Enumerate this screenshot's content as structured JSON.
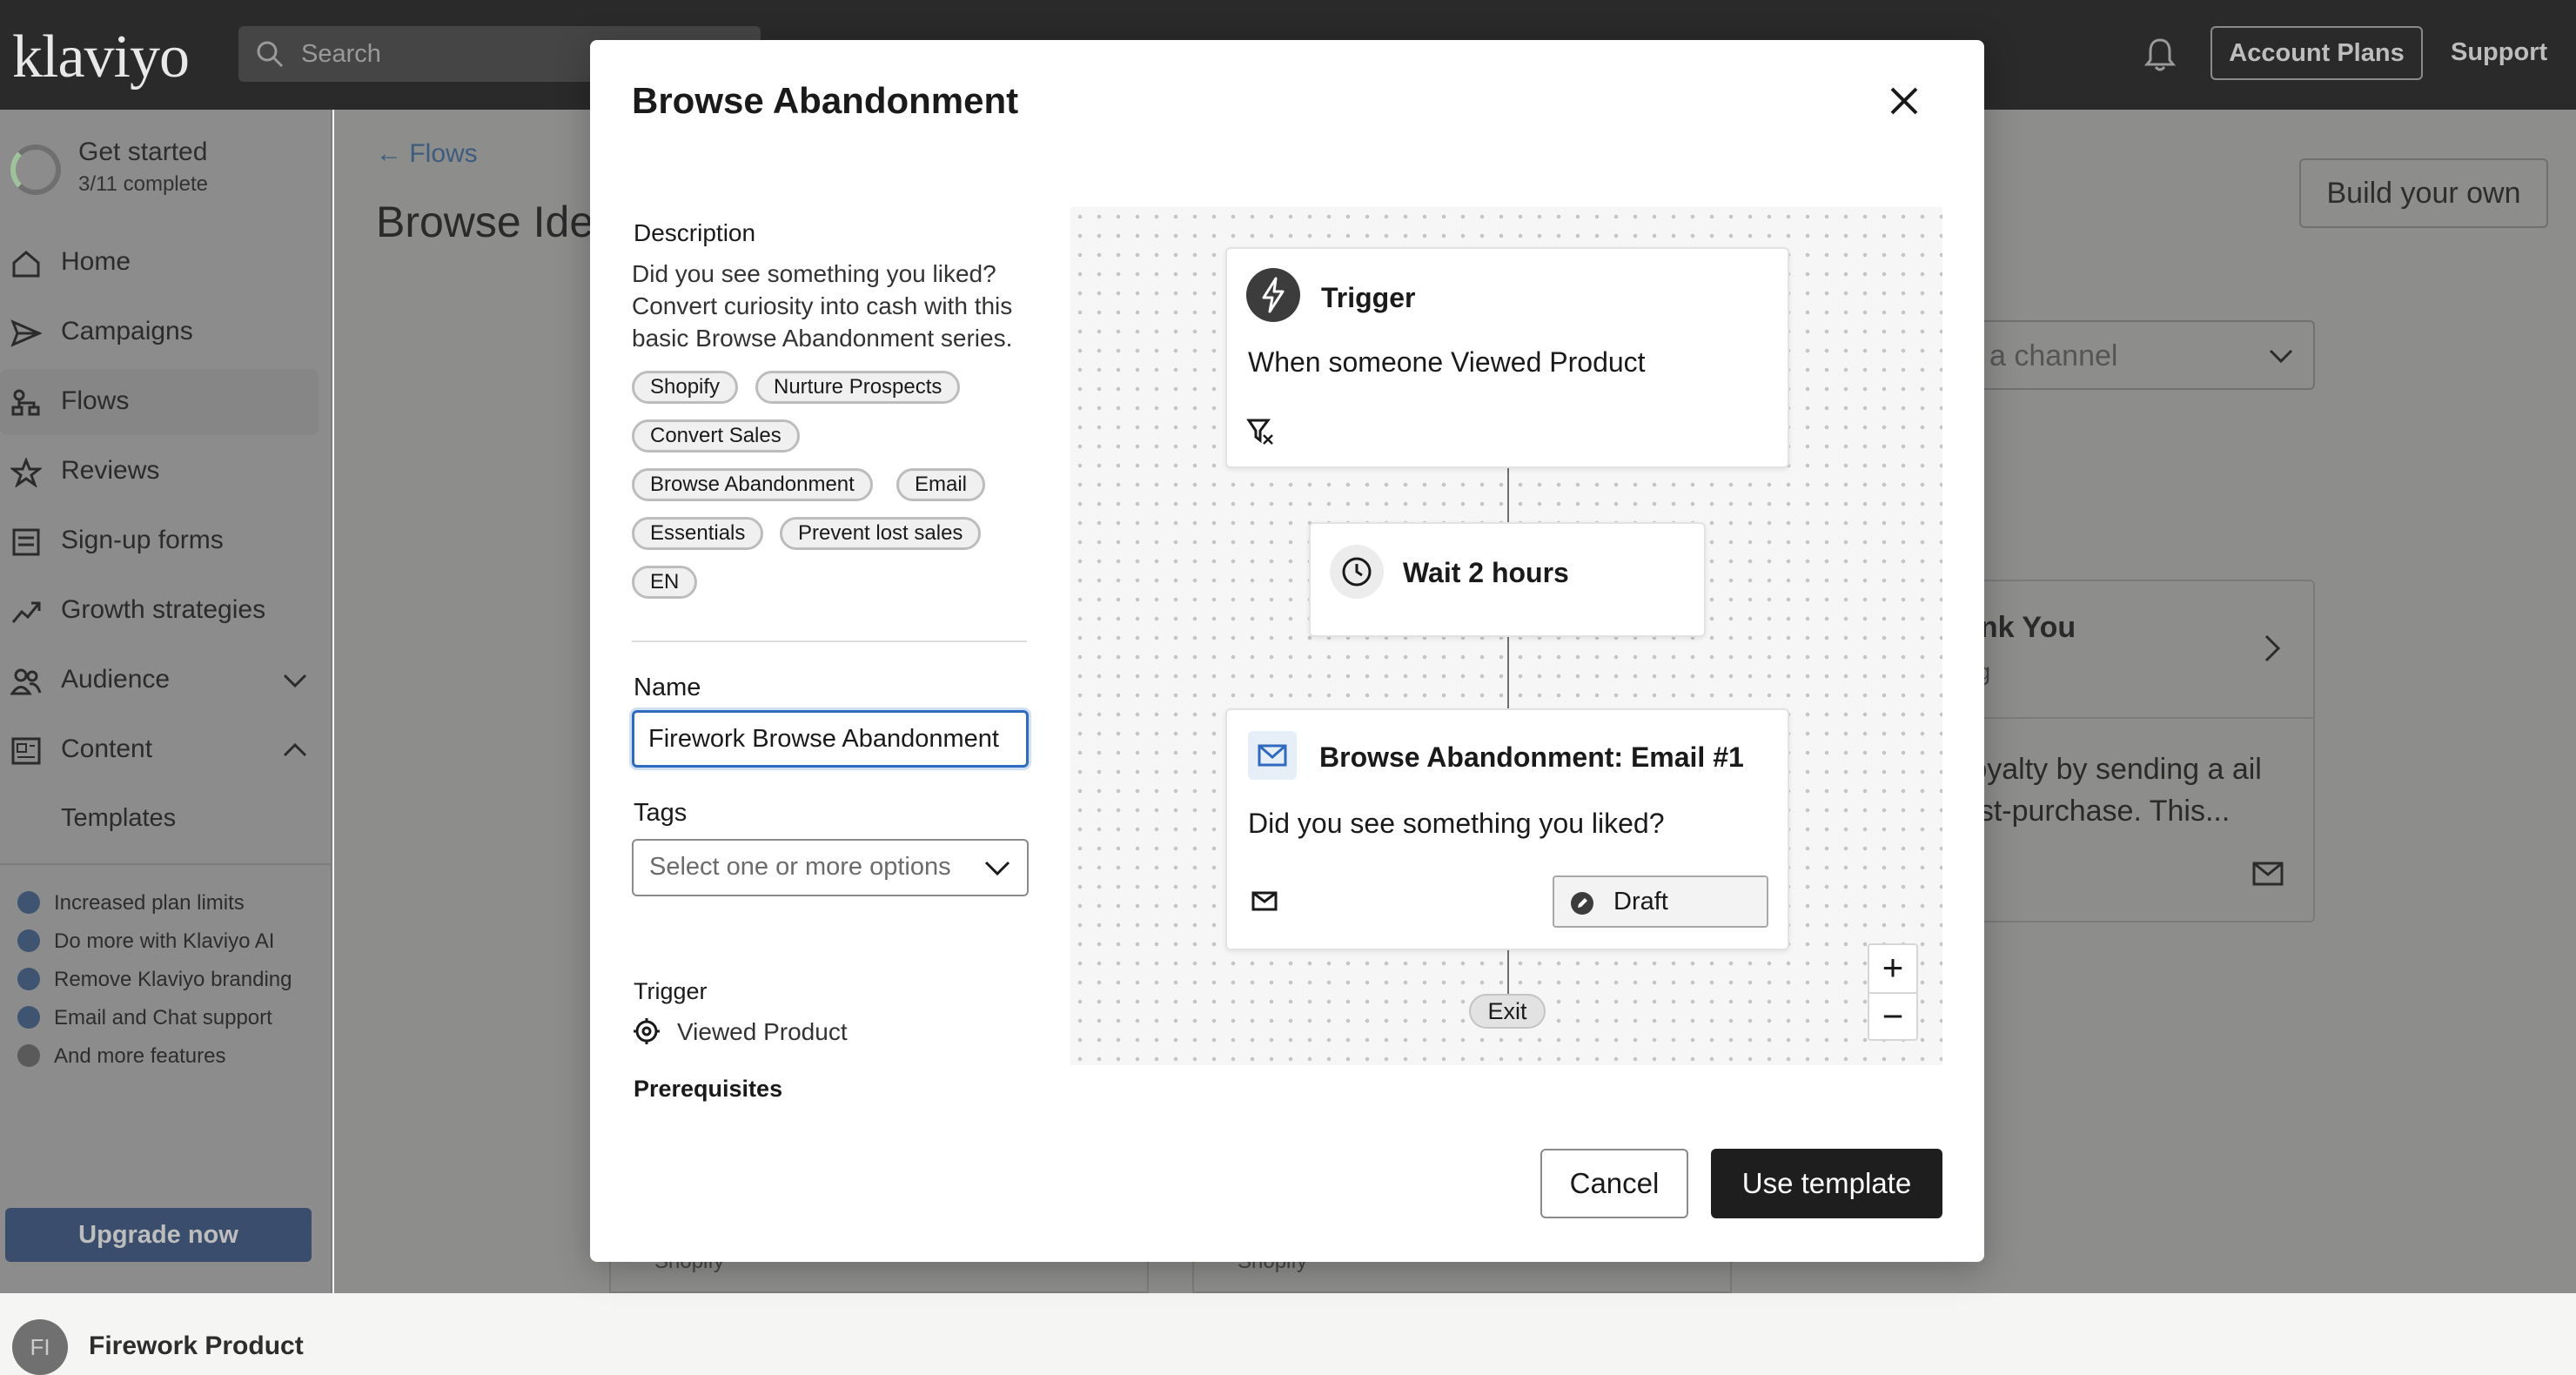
{
  "topbar": {
    "logo": "klaviyo",
    "search_placeholder": "Search",
    "account_plans": "Account Plans",
    "support": "Support"
  },
  "sidebar": {
    "get_started": {
      "title": "Get started",
      "progress": "3/11 complete"
    },
    "items": [
      {
        "label": "Home",
        "icon": "home-icon"
      },
      {
        "label": "Campaigns",
        "icon": "send-icon"
      },
      {
        "label": "Flows",
        "icon": "flows-icon"
      },
      {
        "label": "Reviews",
        "icon": "star-icon"
      },
      {
        "label": "Sign-up forms",
        "icon": "form-icon"
      },
      {
        "label": "Growth strategies",
        "icon": "trend-icon"
      },
      {
        "label": "Audience",
        "icon": "people-icon"
      },
      {
        "label": "Content",
        "icon": "content-icon"
      }
    ],
    "sub_items": [
      "Templates"
    ],
    "upsell": [
      "Increased plan limits",
      "Do more with Klaviyo AI",
      "Remove Klaviyo branding",
      "Email and Chat support",
      "And more features"
    ],
    "upgrade_button": "Upgrade now",
    "user": {
      "initials": "FI",
      "name": "Firework Product"
    }
  },
  "background_page": {
    "back_link": "Flows",
    "title": "Browse Idea",
    "build_button": "Build your own",
    "channel_placeholder": "a channel",
    "card": {
      "title": "ank You",
      "subtitle": "ng",
      "body": "r loyalty by sending a ail post-purchase. This..."
    },
    "shop_tag": "Shopify"
  },
  "modal": {
    "title": "Browse Abandonment",
    "description_label": "Description",
    "description": "Did you see something you liked? Convert curiosity into cash with this basic Browse Abandonment series.",
    "tags_pills": [
      "Shopify",
      "Nurture Prospects",
      "Convert Sales",
      "Browse Abandonment",
      "Email",
      "Essentials",
      "Prevent lost sales",
      "EN"
    ],
    "name_label": "Name",
    "name_value": "Firework Browse Abandonment",
    "tags_label": "Tags",
    "tags_placeholder": "Select one or more options",
    "trigger_label": "Trigger",
    "trigger_value": "Viewed Product",
    "prerequisites_label": "Prerequisites",
    "flow": {
      "trigger_title": "Trigger",
      "trigger_body": "When someone Viewed Product",
      "wait_title": "Wait 2 hours",
      "email_title": "Browse Abandonment: Email #1",
      "email_body": "Did you see something you liked?",
      "draft_label": "Draft",
      "exit_label": "Exit",
      "zoom_in": "+",
      "zoom_out": "−"
    },
    "cancel_button": "Cancel",
    "use_button": "Use template"
  }
}
